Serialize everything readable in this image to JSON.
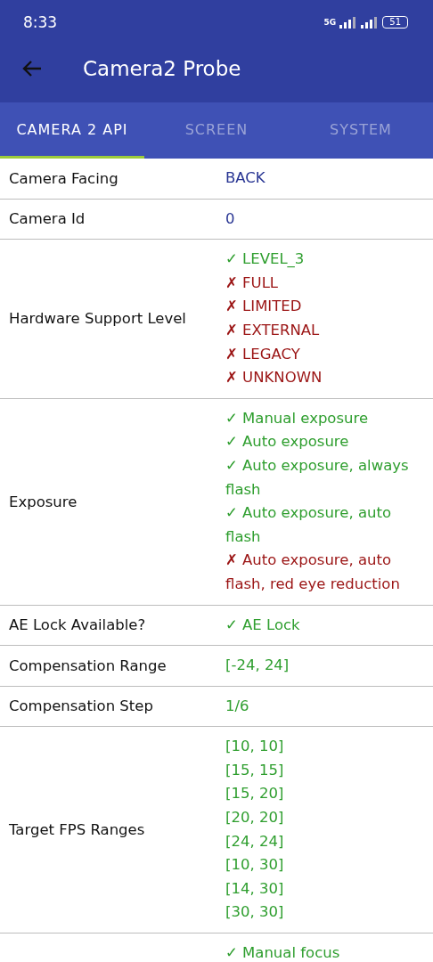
{
  "status_bar": {
    "time": "8:33",
    "network": "5G",
    "battery": "51"
  },
  "app_bar": {
    "title": "Camera2 Probe"
  },
  "tabs": [
    {
      "label": "CAMERA 2 API",
      "selected": true
    },
    {
      "label": "SCREEN",
      "selected": false
    },
    {
      "label": "SYSTEM",
      "selected": false
    }
  ],
  "rows": [
    {
      "label": "Camera Facing",
      "values": [
        {
          "kind": "info",
          "text": "BACK"
        }
      ]
    },
    {
      "label": "Camera Id",
      "values": [
        {
          "kind": "info",
          "text": "0"
        }
      ]
    },
    {
      "label": "Hardware Support Level",
      "values": [
        {
          "kind": "check",
          "text": "✓ LEVEL_3"
        },
        {
          "kind": "cross",
          "text": "✗ FULL"
        },
        {
          "kind": "cross",
          "text": "✗ LIMITED"
        },
        {
          "kind": "cross",
          "text": "✗ EXTERNAL"
        },
        {
          "kind": "cross",
          "text": "✗ LEGACY"
        },
        {
          "kind": "cross",
          "text": "✗ UNKNOWN"
        }
      ]
    },
    {
      "label": "Exposure",
      "values": [
        {
          "kind": "check",
          "text": "✓ Manual exposure"
        },
        {
          "kind": "check",
          "text": "✓ Auto exposure"
        },
        {
          "kind": "check",
          "text": "✓ Auto exposure, always flash"
        },
        {
          "kind": "check",
          "text": "✓ Auto exposure, auto flash"
        },
        {
          "kind": "cross",
          "text": "✗ Auto exposure, auto flash, red eye reduction"
        }
      ]
    },
    {
      "label": "AE Lock Available?",
      "values": [
        {
          "kind": "check",
          "text": "✓ AE Lock"
        }
      ]
    },
    {
      "label": "Compensation Range",
      "values": [
        {
          "kind": "check",
          "text": "[-24, 24]"
        }
      ]
    },
    {
      "label": "Compensation Step",
      "values": [
        {
          "kind": "check",
          "text": "1/6"
        }
      ]
    },
    {
      "label": "Target FPS Ranges",
      "values": [
        {
          "kind": "check",
          "text": "[10, 10]"
        },
        {
          "kind": "check",
          "text": "[15, 15]"
        },
        {
          "kind": "check",
          "text": "[15, 20]"
        },
        {
          "kind": "check",
          "text": "[20, 20]"
        },
        {
          "kind": "check",
          "text": "[24, 24]"
        },
        {
          "kind": "check",
          "text": "[10, 30]"
        },
        {
          "kind": "check",
          "text": "[14, 30]"
        },
        {
          "kind": "check",
          "text": "[30, 30]"
        }
      ]
    },
    {
      "label": "",
      "values": [
        {
          "kind": "check",
          "text": "✓ Manual focus"
        }
      ]
    }
  ]
}
